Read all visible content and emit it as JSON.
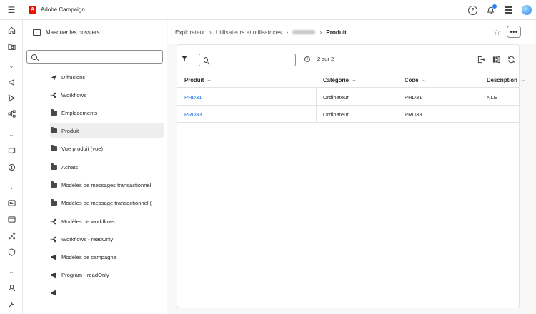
{
  "app": {
    "name": "Adobe Campaign"
  },
  "folders_panel": {
    "toggle_label": "Masquer les dossiers",
    "search_placeholder": "",
    "items": [
      {
        "label": "Diffusions",
        "icon": "send-icon"
      },
      {
        "label": "Workflows",
        "icon": "workflow-icon"
      },
      {
        "label": "Emplacements",
        "icon": "folder-icon"
      },
      {
        "label": "Produit",
        "icon": "folder-icon",
        "selected": true
      },
      {
        "label": "Vue produit (vue)",
        "icon": "folder-icon"
      },
      {
        "label": "Achats",
        "icon": "folder-icon"
      },
      {
        "label": "Modèles de messages transactionnel",
        "icon": "folder-icon"
      },
      {
        "label": "Modèles de message transactionnel (",
        "icon": "folder-icon"
      },
      {
        "label": "Modèles de workflows",
        "icon": "workflow-icon"
      },
      {
        "label": "Workflows - readOnly",
        "icon": "workflow-icon"
      },
      {
        "label": "Modèles de campagne",
        "icon": "megaphone-icon"
      },
      {
        "label": "Program - readOnly",
        "icon": "megaphone-icon"
      }
    ]
  },
  "breadcrumb": {
    "items": [
      "Explorateur",
      "Utilisateurs et utilisatrices"
    ],
    "current": "Produit"
  },
  "table": {
    "search_placeholder": "",
    "count_text": "2 sur 2",
    "columns": [
      "Produit",
      "Catégorie",
      "Code",
      "Description"
    ],
    "rows": [
      {
        "produit": "PRD31",
        "categorie": "Ordinateur",
        "code": "PRD31",
        "description": "NLE"
      },
      {
        "produit": "PRD33",
        "categorie": "Ordinateur",
        "code": "PRD33",
        "description": ""
      }
    ]
  },
  "colors": {
    "accent": "#1473e6",
    "brand": "#eb1000",
    "notification": "#2680eb"
  }
}
